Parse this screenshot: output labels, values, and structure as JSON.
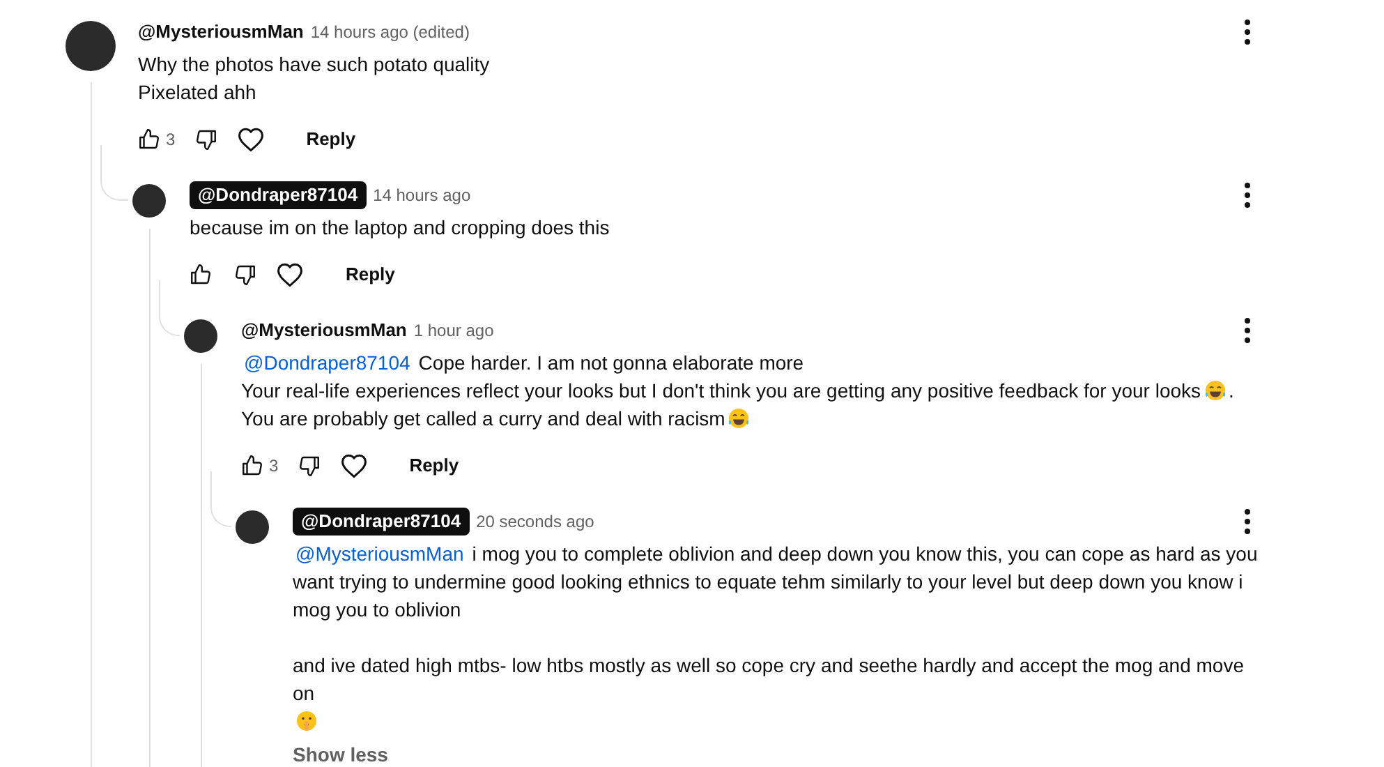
{
  "comments": [
    {
      "author": "@MysteriousmMan",
      "author_highlighted": false,
      "time": "14 hours ago (edited)",
      "paragraphs": [
        [
          {
            "segments": [
              {
                "kind": "text",
                "text": "Why the photos have such potato quality"
              }
            ]
          },
          {
            "segments": [
              {
                "kind": "text",
                "text": "Pixelated ahh"
              }
            ]
          }
        ]
      ],
      "likes": "3",
      "reply": "Reply",
      "replies": [
        {
          "author": "@Dondraper87104",
          "author_highlighted": true,
          "time": "14 hours ago",
          "paragraphs": [
            [
              {
                "segments": [
                  {
                    "kind": "text",
                    "text": "because im on the laptop and cropping does this"
                  }
                ]
              }
            ]
          ],
          "reply": "Reply",
          "replies": [
            {
              "author": "@MysteriousmMan",
              "author_highlighted": false,
              "time": "1 hour ago",
              "paragraphs": [
                [
                  {
                    "segments": [
                      {
                        "kind": "mention",
                        "text": "@Dondraper87104"
                      },
                      {
                        "kind": "text",
                        "text": "Cope harder. I am not gonna elaborate more"
                      }
                    ]
                  },
                  {
                    "segments": [
                      {
                        "kind": "text",
                        "text": "Your real-life experiences reflect your looks but I don't think you are getting any positive feedback for your looks"
                      },
                      {
                        "kind": "emoji-laugh"
                      },
                      {
                        "kind": "text",
                        "text": "."
                      }
                    ]
                  },
                  {
                    "segments": [
                      {
                        "kind": "text",
                        "text": "You are probably get called a curry and deal with racism"
                      },
                      {
                        "kind": "emoji-laugh"
                      }
                    ]
                  }
                ]
              ],
              "likes": "3",
              "reply": "Reply",
              "replies": [
                {
                  "author": "@Dondraper87104",
                  "author_highlighted": true,
                  "time": "20 seconds ago",
                  "paragraphs": [
                    [
                      {
                        "segments": [
                          {
                            "kind": "mention",
                            "text": "@MysteriousmMan"
                          },
                          {
                            "kind": "text",
                            "text": "i mog you to complete oblivion and deep down you know this, you can cope as hard as you want trying to undermine good looking ethnics to equate tehm similarly to your level but deep down you know i mog you to oblivion"
                          }
                        ]
                      }
                    ],
                    [
                      {
                        "segments": [
                          {
                            "kind": "text",
                            "text": "and ive dated high mtbs- low htbs mostly as well so cope cry and seethe hardly and accept the mog and move on"
                          }
                        ]
                      },
                      {
                        "segments": [
                          {
                            "kind": "emoji-shush"
                          }
                        ]
                      }
                    ]
                  ],
                  "show_less": "Show less"
                }
              ]
            }
          ]
        }
      ]
    }
  ]
}
